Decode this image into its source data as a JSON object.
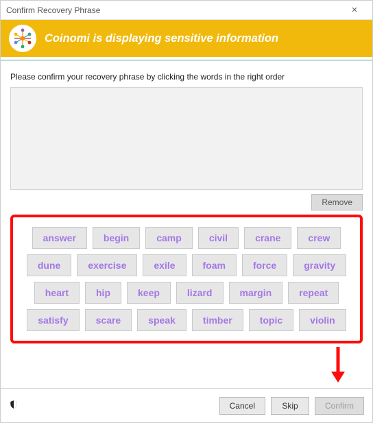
{
  "window": {
    "title": "Confirm Recovery Phrase"
  },
  "banner": {
    "title": "Coinomi is displaying sensitive information"
  },
  "instruction": "Please confirm your recovery phrase by clicking the words in the right order",
  "remove_label": "Remove",
  "words": [
    "answer",
    "begin",
    "camp",
    "civil",
    "crane",
    "crew",
    "dune",
    "exercise",
    "exile",
    "foam",
    "force",
    "gravity",
    "heart",
    "hip",
    "keep",
    "lizard",
    "margin",
    "repeat",
    "satisfy",
    "scare",
    "speak",
    "timber",
    "topic",
    "violin"
  ],
  "footer": {
    "cancel": "Cancel",
    "skip": "Skip",
    "confirm": "Confirm"
  },
  "colors": {
    "accent_yellow": "#f1b90c",
    "word_text": "#a378e6",
    "highlight_red": "#ff0b0a"
  }
}
